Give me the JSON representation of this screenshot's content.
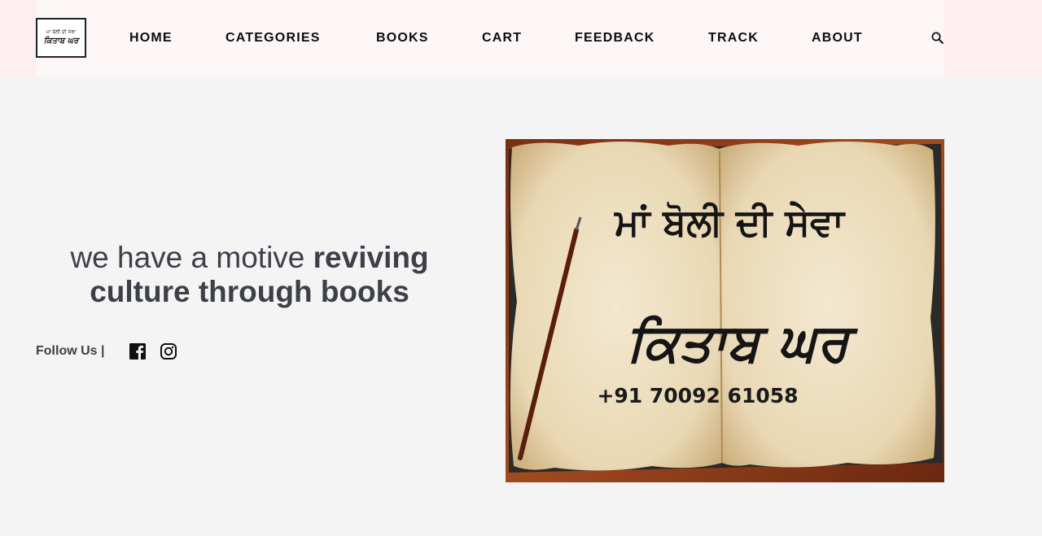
{
  "brand": {
    "logo_top": "ਮਾਂ ਬੋਲੀ ਦੀ ਸੇਵਾ",
    "logo_main": "ਕਿਤਾਬ ਘਰ"
  },
  "nav": {
    "items": [
      {
        "label": "HOME"
      },
      {
        "label": "CATEGORIES"
      },
      {
        "label": "BOOKS"
      },
      {
        "label": "CART"
      },
      {
        "label": "FEEDBACK"
      },
      {
        "label": "TRACK"
      },
      {
        "label": "ABOUT"
      }
    ],
    "search_icon": "search-icon"
  },
  "hero": {
    "tagline_plain": "we have a motive ",
    "tagline_bold_1": "reviving",
    "tagline_bold_2": "culture through books",
    "follow_label": "Follow Us |",
    "social": [
      {
        "icon": "facebook-icon"
      },
      {
        "icon": "instagram-icon"
      }
    ],
    "image": {
      "line1": "ਮਾਂ ਬੋਲੀ ਦੀ ਸੇਵਾ",
      "line2": "ਕਿਤਾਬ ਘਰ",
      "phone": "+91 70092 61058"
    }
  },
  "colors": {
    "header_bg": "#fdeef0",
    "page_bg": "#f4f4f4",
    "text_dark": "#3d3f49",
    "nav_text": "#0c0c0c"
  }
}
